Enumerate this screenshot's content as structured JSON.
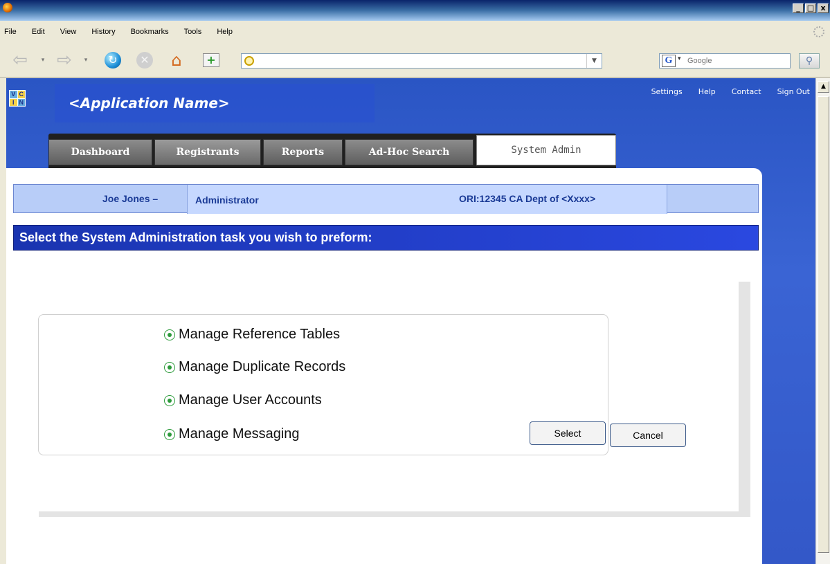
{
  "browser": {
    "menu": [
      "File",
      "Edit",
      "View",
      "History",
      "Bookmarks",
      "Tools",
      "Help"
    ],
    "url": "",
    "search_placeholder": "Google",
    "window_buttons": [
      "_",
      "□",
      "x"
    ]
  },
  "app": {
    "logo_letters": [
      "V",
      "C",
      "I",
      "N"
    ],
    "title": "<Application Name>",
    "top_links": [
      "Settings",
      "Help",
      "Contact",
      "Sign Out"
    ],
    "tabs": [
      {
        "label": "Dashboard"
      },
      {
        "label": "Registrants"
      },
      {
        "label": "Reports"
      },
      {
        "label": "Ad-Hoc Search"
      },
      {
        "label": "System Admin",
        "active": true
      }
    ]
  },
  "user_bar": {
    "name": "Joe Jones –",
    "role": "Administrator",
    "ori": "ORI:12345 CA Dept of <Xxxx>"
  },
  "task_heading": "Select the System Administration task you wish to preform:",
  "options": [
    {
      "label": "Manage Reference Tables",
      "selected": true
    },
    {
      "label": "Manage Duplicate Records",
      "selected": true
    },
    {
      "label": "Manage User Accounts",
      "selected": true
    },
    {
      "label": "Manage Messaging",
      "selected": true
    }
  ],
  "buttons": {
    "select": "Select",
    "cancel": "Cancel"
  }
}
